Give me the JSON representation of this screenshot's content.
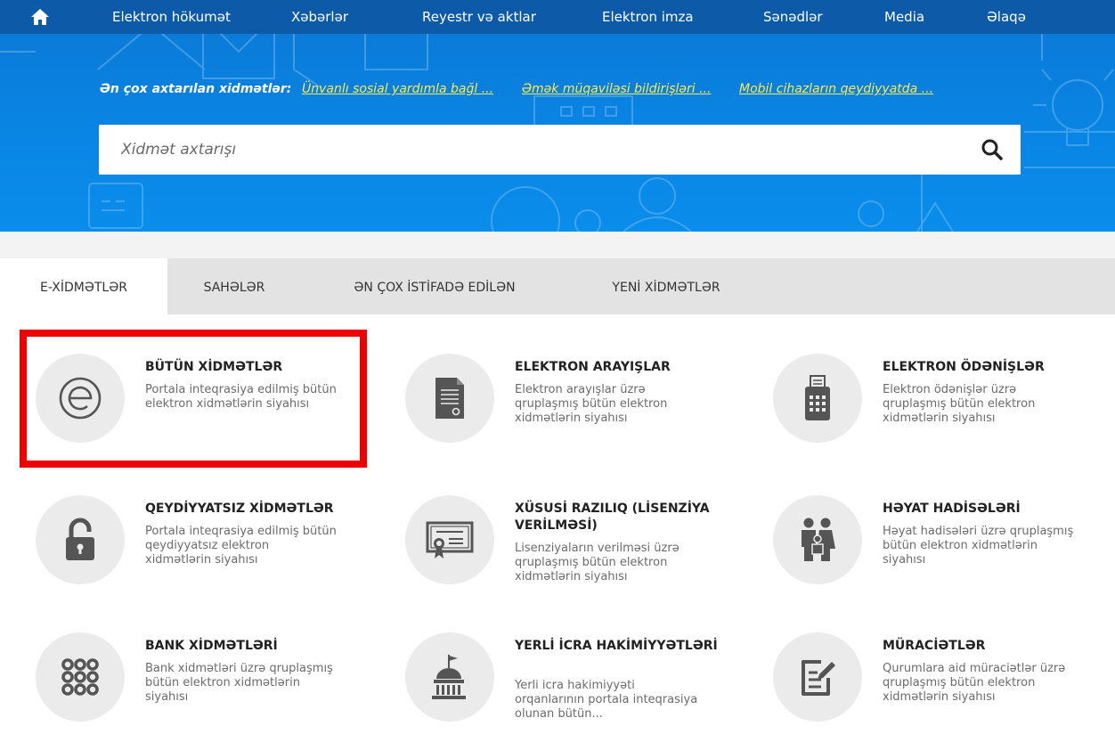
{
  "nav": {
    "home_icon": "home-icon",
    "items": [
      {
        "label": "Elektron hökumət"
      },
      {
        "label": "Xəbərlər"
      },
      {
        "label": "Reyestr və aktlar"
      },
      {
        "label": "Elektron imza"
      },
      {
        "label": "Sənədlər"
      },
      {
        "label": "Media"
      },
      {
        "label": "Əlaqə"
      }
    ]
  },
  "hero": {
    "popular_label": "Ən çox axtarılan xidmətlər:",
    "popular_links": [
      {
        "text": "Ünvanlı sosial yardımla bağl ..."
      },
      {
        "text": "Əmək müqaviləsi bildirişləri ..."
      },
      {
        "text": "Mobil cihazların qeydiyyatda ..."
      }
    ],
    "search": {
      "placeholder": "Xidmət axtarışı",
      "value": "",
      "icon": "search-icon"
    }
  },
  "tabs": [
    {
      "label": "E-XİDMƏTLƏR",
      "active": true
    },
    {
      "label": "SAHƏLƏR",
      "active": false
    },
    {
      "label": "ƏN ÇOX İSTİFADƏ EDİLƏN",
      "active": false
    },
    {
      "label": "YENİ XİDMƏTLƏR",
      "active": false
    }
  ],
  "services": [
    {
      "title": "BÜTÜN XİDMƏTLƏR",
      "desc": "Portala inteqrasiya edilmiş bütün elektron xidmətlərin siyahısı",
      "icon": "e-logo-icon"
    },
    {
      "title": "ELEKTRON ARAYIŞLAR",
      "desc": "Elektron arayışlar üzrə qruplaşmış bütün elektron xidmətlərin siyahısı",
      "icon": "document-icon"
    },
    {
      "title": "ELEKTRON ÖDƏNİŞLƏR",
      "desc": "Elektron ödənişlər üzrə qruplaşmış bütün elektron xidmətlərin siyahısı",
      "icon": "payment-terminal-icon"
    },
    {
      "title": "QEYDİYYATSIZ XİDMƏTLƏR",
      "desc": "Portala inteqrasiya edilmiş bütün qeydiyyatsız elektron xidmətlərin siyahısı",
      "icon": "unlocked-padlock-icon"
    },
    {
      "title": "XÜSUSİ RAZILIQ (LİSENZİYA VERİLMƏSİ)",
      "desc": "Lisenziyaların verilməsi üzrə qruplaşmış bütün elektron xidmətlərin siyahısı",
      "icon": "certificate-icon"
    },
    {
      "title": "HƏYAT HADİSƏLƏRİ",
      "desc": "Həyat hadisələri üzrə qruplaşmış bütün elektron xidmətlərin siyahısı",
      "icon": "family-icon"
    },
    {
      "title": "BANK XİDMƏTLƏRİ",
      "desc": "Bank xidmətləri üzrə qruplaşmış bütün elektron xidmətlərin siyahısı",
      "icon": "dots-grid-icon"
    },
    {
      "title": "YERLİ İCRA HAKİMİYYƏTLƏRİ",
      "desc": "Yerli icra hakimiyyəti orqanlarının portala inteqrasiya olunan bütün...",
      "icon": "government-building-icon"
    },
    {
      "title": "MÜRACİƏTLƏR",
      "desc": "Qurumlara aid müraciətlər üzrə qruplaşmış bütün elektron xidmətlərin siyahısı",
      "icon": "edit-document-icon"
    }
  ],
  "colors": {
    "nav_bg": "#0c5aa8",
    "hero_bg": "#0986e5",
    "link": "#ffe94a",
    "highlight": "#ee0000",
    "icon": "#555555"
  }
}
